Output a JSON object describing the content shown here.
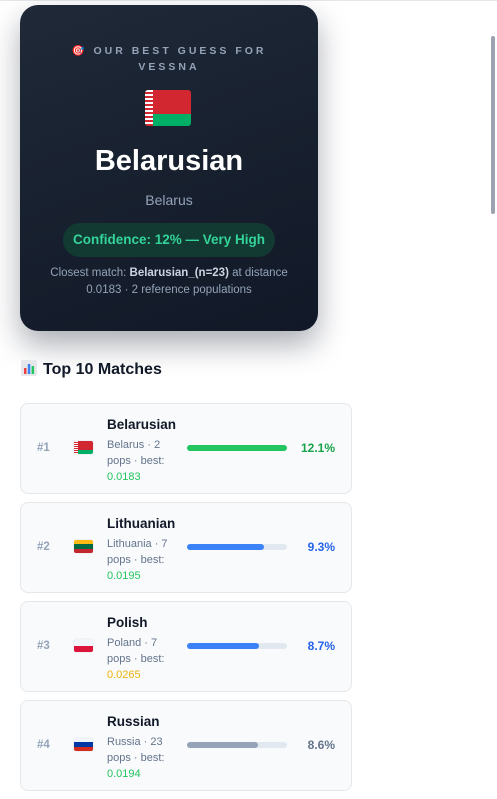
{
  "hero": {
    "eyebrow": "🎯 OUR BEST GUESS FOR VESSNA",
    "flag": "belarus-flag",
    "title": "Belarusian",
    "country": "Belarus",
    "confidence": "Confidence: 12% — Very High",
    "closest_prefix": "Closest match: ",
    "closest_name": "Belarusian_(n=23)",
    "closest_suffix": " at distance 0.0183 · 2 reference populations"
  },
  "section": {
    "icon": "bar-chart-icon",
    "title": "Top 10 Matches"
  },
  "matches": [
    {
      "rank": "#1",
      "flag": "belarus-flag",
      "name": "Belarusian",
      "meta": "Belarus · 2 pops · best:",
      "best": "0.0183",
      "best_color": "#22c55e",
      "pct": "12.1%",
      "share": 1.0,
      "bar_color": "#22c55e",
      "pct_color": "#16a34a"
    },
    {
      "rank": "#2",
      "flag": "lithuania-flag",
      "name": "Lithuanian",
      "meta": "Lithuania · 7 pops · best:",
      "best": "0.0195",
      "best_color": "#22c55e",
      "pct": "9.3%",
      "share": 0.77,
      "bar_color": "#3b82f6",
      "pct_color": "#2563eb"
    },
    {
      "rank": "#3",
      "flag": "poland-flag",
      "name": "Polish",
      "meta": "Poland · 7 pops · best:",
      "best": "0.0265",
      "best_color": "#eab308",
      "pct": "8.7%",
      "share": 0.72,
      "bar_color": "#3b82f6",
      "pct_color": "#2563eb"
    },
    {
      "rank": "#4",
      "flag": "russia-flag",
      "name": "Russian",
      "meta": "Russia · 23 pops · best:",
      "best": "0.0194",
      "best_color": "#22c55e",
      "pct": "8.6%",
      "share": 0.71,
      "bar_color": "#94a3b8",
      "pct_color": "#64748b"
    }
  ]
}
